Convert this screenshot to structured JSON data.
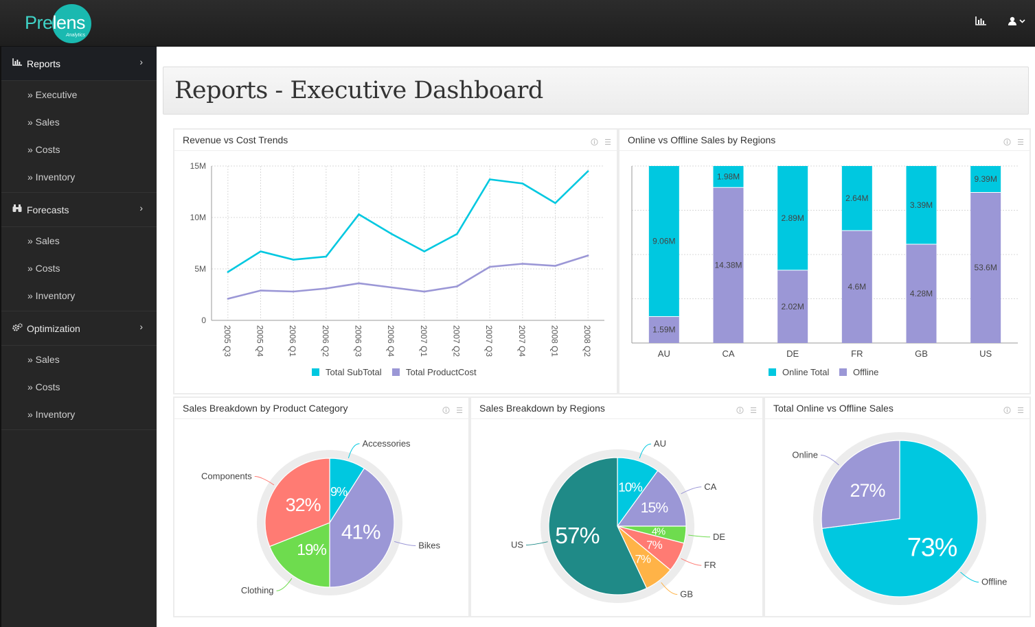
{
  "brand": {
    "logo_text_a": "Pre",
    "logo_text_b": "lens",
    "logo_sub": "Analytics"
  },
  "topbar": {
    "chart_icon": "bar-chart-icon",
    "user_icon": "user-icon"
  },
  "sidebar": {
    "sections": [
      {
        "label": "Reports",
        "icon": "bar-chart-icon",
        "items": [
          "» Executive",
          "» Sales",
          "» Costs",
          "» Inventory"
        ]
      },
      {
        "label": "Forecasts",
        "icon": "binoculars-icon",
        "items": [
          "» Sales",
          "» Costs",
          "» Inventory"
        ]
      },
      {
        "label": "Optimization",
        "icon": "gears-icon",
        "items": [
          "» Sales",
          "» Costs",
          "» Inventory"
        ]
      }
    ]
  },
  "page_title": "Reports - Executive Dashboard",
  "panels": {
    "trend": "Revenue vs Cost Trends",
    "regions_bar": "Online vs Offline Sales by Regions",
    "category_pie": "Sales Breakdown by Product Category",
    "regions_pie": "Sales Breakdown by Regions",
    "online_pie": "Total Online vs Offline Sales"
  },
  "colors": {
    "cyan": "#00c8e0",
    "purple": "#9b97d6",
    "red": "#ff7b73",
    "green": "#6edc4e",
    "teal": "#1f8a87",
    "orange": "#ffb347"
  },
  "chart_data": [
    {
      "type": "line",
      "title": "Revenue vs Cost Trends",
      "x": [
        "2005 Q3",
        "2005 Q4",
        "2006 Q1",
        "2006 Q2",
        "2006 Q3",
        "2006 Q4",
        "2007 Q1",
        "2007 Q2",
        "2007 Q3",
        "2007 Q4",
        "2008 Q1",
        "2008 Q2"
      ],
      "yticks": [
        "0",
        "5M",
        "10M",
        "15M"
      ],
      "ylim": [
        0,
        15
      ],
      "series": [
        {
          "name": "Total SubTotal",
          "color": "#00c8e0",
          "values": [
            4.7,
            6.7,
            5.9,
            6.2,
            10.3,
            8.4,
            6.7,
            8.4,
            13.7,
            13.3,
            11.4,
            14.5
          ]
        },
        {
          "name": "Total ProductCost",
          "color": "#9b97d6",
          "values": [
            2.1,
            2.9,
            2.8,
            3.1,
            3.6,
            3.2,
            2.8,
            3.3,
            5.2,
            5.5,
            5.3,
            6.3
          ]
        }
      ]
    },
    {
      "type": "bar",
      "stacked": "percent",
      "title": "Online vs Offline Sales by Regions",
      "categories": [
        "AU",
        "CA",
        "DE",
        "FR",
        "GB",
        "US"
      ],
      "series": [
        {
          "name": "Online Total",
          "color": "#00c8e0",
          "values": [
            9.06,
            1.98,
            2.89,
            2.64,
            3.39,
            9.39
          ],
          "labels": [
            "9.06M",
            "1.98M",
            "2.89M",
            "2.64M",
            "3.39M",
            "9.39M"
          ]
        },
        {
          "name": "Offline",
          "color": "#9b97d6",
          "values": [
            1.59,
            14.38,
            2.02,
            4.6,
            4.28,
            53.6
          ],
          "labels": [
            "1.59M",
            "14.38M",
            "2.02M",
            "4.6M",
            "4.28M",
            "53.6M"
          ]
        }
      ]
    },
    {
      "type": "pie",
      "title": "Sales Breakdown by Product Category",
      "slices": [
        {
          "name": "Accessories",
          "value": 9,
          "label": "9%",
          "color": "#00c8e0"
        },
        {
          "name": "Bikes",
          "value": 41,
          "label": "41%",
          "color": "#9b97d6"
        },
        {
          "name": "Clothing",
          "value": 19,
          "label": "19%",
          "color": "#6edc4e"
        },
        {
          "name": "Components",
          "value": 31,
          "label": "32%",
          "color": "#ff7b73"
        }
      ]
    },
    {
      "type": "pie",
      "title": "Sales Breakdown by Regions",
      "slices": [
        {
          "name": "AU",
          "value": 10,
          "label": "10%",
          "color": "#00c8e0"
        },
        {
          "name": "CA",
          "value": 15,
          "label": "15%",
          "color": "#9b97d6"
        },
        {
          "name": "DE",
          "value": 4,
          "label": "4%",
          "color": "#6edc4e"
        },
        {
          "name": "FR",
          "value": 7,
          "label": "7%",
          "color": "#ff7b73"
        },
        {
          "name": "GB",
          "value": 7,
          "label": "7%",
          "color": "#ffb347"
        },
        {
          "name": "US",
          "value": 57,
          "label": "57%",
          "color": "#1f8a87"
        }
      ]
    },
    {
      "type": "pie",
      "title": "Total Online vs Offline Sales",
      "slices": [
        {
          "name": "Offline",
          "value": 73,
          "label": "73%",
          "color": "#00c8e0"
        },
        {
          "name": "Online",
          "value": 27,
          "label": "27%",
          "color": "#9b97d6"
        }
      ]
    }
  ]
}
